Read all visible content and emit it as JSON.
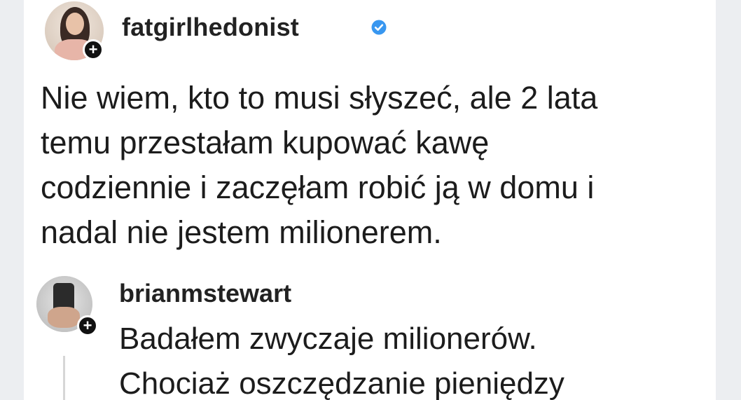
{
  "post": {
    "username": "fatgirlhedonist",
    "verified": true,
    "follow_badge": "+",
    "lines": [
      "Nie wiem, kto to musi słyszeć, ale 2 lata",
      "temu przestałam kupować kawę",
      "codziennie i zaczęłam robić ją w domu i",
      "nadal nie jestem milionerem."
    ]
  },
  "comment": {
    "username": "brianmstewart",
    "follow_badge": "+",
    "lines": [
      "Badałem zwyczaje milionerów.",
      "Chociaż oszczędzanie pieniędzy"
    ]
  },
  "colors": {
    "verified_badge": "#3897f0",
    "text": "#1c1c1c",
    "background": "#ffffff"
  },
  "icons": {
    "verified": "verified-badge-icon",
    "follow": "plus-icon"
  }
}
